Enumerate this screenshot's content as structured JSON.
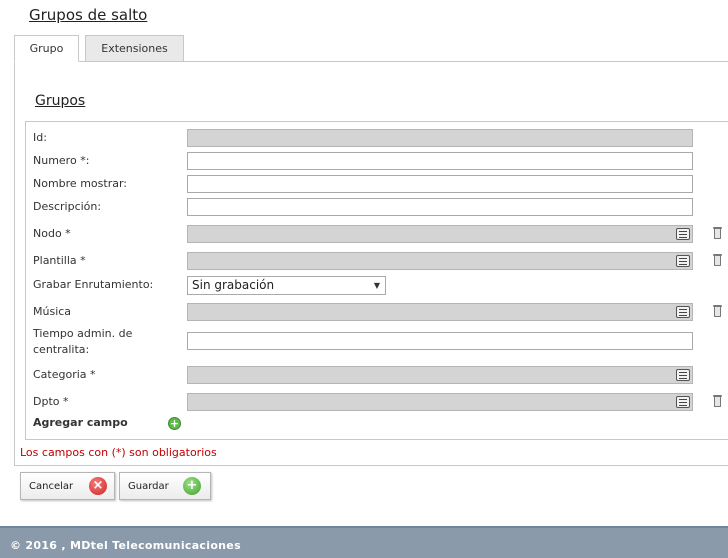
{
  "page": {
    "title": "Grupos de salto"
  },
  "tabs": [
    {
      "label": "Grupo",
      "active": true
    },
    {
      "label": "Extensiones",
      "active": false
    }
  ],
  "section": {
    "title": "Grupos"
  },
  "form": {
    "fields": {
      "id": {
        "label": "Id:",
        "value": ""
      },
      "numero": {
        "label": "Numero *:",
        "value": ""
      },
      "nombre": {
        "label": "Nombre mostrar:",
        "value": ""
      },
      "descripcion": {
        "label": "Descripción:",
        "value": ""
      },
      "nodo": {
        "label": "Nodo *",
        "value": ""
      },
      "plantilla": {
        "label": "Plantilla *",
        "value": ""
      },
      "grabar": {
        "label": "Grabar Enrutamiento:",
        "value": "Sin grabación"
      },
      "musica": {
        "label": "Música",
        "value": ""
      },
      "tiempo": {
        "label_line1": "Tiempo admin. de",
        "label_line2": "centralita:",
        "value": ""
      },
      "categoria": {
        "label": "Categoria *",
        "value": ""
      },
      "dpto": {
        "label": "Dpto *",
        "value": ""
      }
    },
    "add_field_label": "Agregar campo",
    "required_note": "Los campos con (*) son obligatorios"
  },
  "buttons": {
    "cancel": "Cancelar",
    "save": "Guardar"
  },
  "footer": {
    "text": "© 2016 , MDtel Telecomunicaciones"
  },
  "icons": {
    "list": "list-icon",
    "delete": "trash-icon",
    "add": "plus-circle-icon",
    "cancel": "x-circle-icon",
    "save": "plus-circle-icon"
  }
}
